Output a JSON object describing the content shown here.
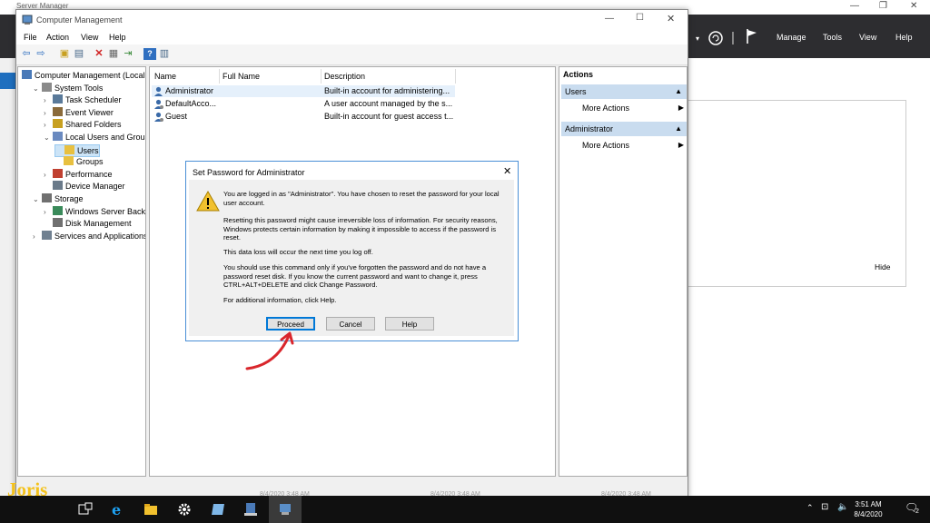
{
  "server_manager": {
    "title": "Server Manager",
    "menu": [
      "Manage",
      "Tools",
      "View",
      "Help"
    ],
    "hide_label": "Hide"
  },
  "window": {
    "title": "Computer Management",
    "menu": [
      "File",
      "Action",
      "View",
      "Help"
    ]
  },
  "tree": [
    {
      "label": "Computer Management (Local",
      "level": 0,
      "chevron": ""
    },
    {
      "label": "System Tools",
      "level": 1,
      "chevron": "v"
    },
    {
      "label": "Task Scheduler",
      "level": 2,
      "chevron": ">"
    },
    {
      "label": "Event Viewer",
      "level": 2,
      "chevron": ">"
    },
    {
      "label": "Shared Folders",
      "level": 2,
      "chevron": ">"
    },
    {
      "label": "Local Users and Groups",
      "level": 2,
      "chevron": "v"
    },
    {
      "label": "Users",
      "level": 3,
      "chevron": "",
      "selected": true
    },
    {
      "label": "Groups",
      "level": 3,
      "chevron": ""
    },
    {
      "label": "Performance",
      "level": 2,
      "chevron": ">"
    },
    {
      "label": "Device Manager",
      "level": 2,
      "chevron": ""
    },
    {
      "label": "Storage",
      "level": 1,
      "chevron": "v"
    },
    {
      "label": "Windows Server Backup",
      "level": 2,
      "chevron": ">"
    },
    {
      "label": "Disk Management",
      "level": 2,
      "chevron": ""
    },
    {
      "label": "Services and Applications",
      "level": 1,
      "chevron": ">"
    }
  ],
  "list": {
    "columns": [
      "Name",
      "Full Name",
      "Description"
    ],
    "rows": [
      {
        "name": "Administrator",
        "full_name": "",
        "description": "Built-in account for administering..."
      },
      {
        "name": "DefaultAcco...",
        "full_name": "",
        "description": "A user account managed by the s..."
      },
      {
        "name": "Guest",
        "full_name": "",
        "description": "Built-in account for guest access t..."
      }
    ]
  },
  "actions": {
    "header": "Actions",
    "sections": [
      {
        "title": "Users",
        "items": [
          "More Actions"
        ]
      },
      {
        "title": "Administrator",
        "items": [
          "More Actions"
        ]
      }
    ]
  },
  "dialog": {
    "title": "Set Password for Administrator",
    "paragraphs": [
      "You are logged in as \"Administrator\". You have chosen to reset the password for your local user account.",
      "Resetting this password might cause irreversible loss of information. For security reasons, Windows protects certain information by making it impossible to access if the password is reset.",
      "This data loss will occur the next time you log off.",
      "You should use this command only if you've forgotten the password and do not have a password reset disk. If you know the current password and want to change it, press CTRL+ALT+DELETE and click Change Password.",
      "For additional information, click Help."
    ],
    "buttons": {
      "proceed": "Proceed",
      "cancel": "Cancel",
      "help": "Help"
    }
  },
  "taskbar": {
    "time": "3:51 AM",
    "date": "8/4/2020",
    "notification_count": "2"
  },
  "status_timestamps": [
    "8/4/2020 3:48 AM",
    "8/4/2020 3:48 AM",
    "8/4/2020 3:48 AM"
  ],
  "logo": {
    "text": "Joris"
  },
  "colors": {
    "accent": "#0078d7",
    "arrow": "#d9262c",
    "logo": "#f4c21b",
    "section": "#c9dcef"
  }
}
